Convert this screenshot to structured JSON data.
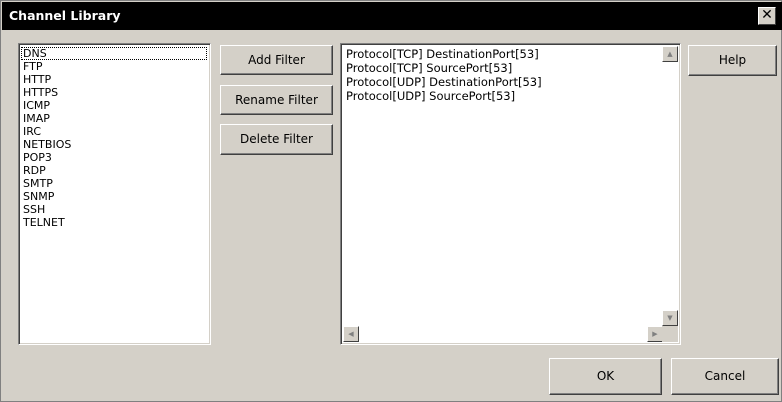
{
  "window": {
    "title": "Channel Library",
    "close_glyph": "✕"
  },
  "channels": {
    "items": [
      "DNS",
      "FTP",
      "HTTP",
      "HTTPS",
      "ICMP",
      "IMAP",
      "IRC",
      "NETBIOS",
      "POP3",
      "RDP",
      "SMTP",
      "SNMP",
      "SSH",
      "TELNET"
    ],
    "selected": "DNS"
  },
  "buttons": {
    "add_filter": "Add Filter",
    "rename_filter": "Rename Filter",
    "delete_filter": "Delete Filter",
    "help": "Help",
    "ok": "OK",
    "cancel": "Cancel"
  },
  "filters": {
    "items": [
      "Protocol[TCP] DestinationPort[53]",
      "Protocol[TCP] SourcePort[53]",
      "Protocol[UDP] DestinationPort[53]",
      "Protocol[UDP] SourcePort[53]"
    ]
  },
  "scroll_glyphs": {
    "up": "▲",
    "down": "▼",
    "left": "◀",
    "right": "▶"
  }
}
